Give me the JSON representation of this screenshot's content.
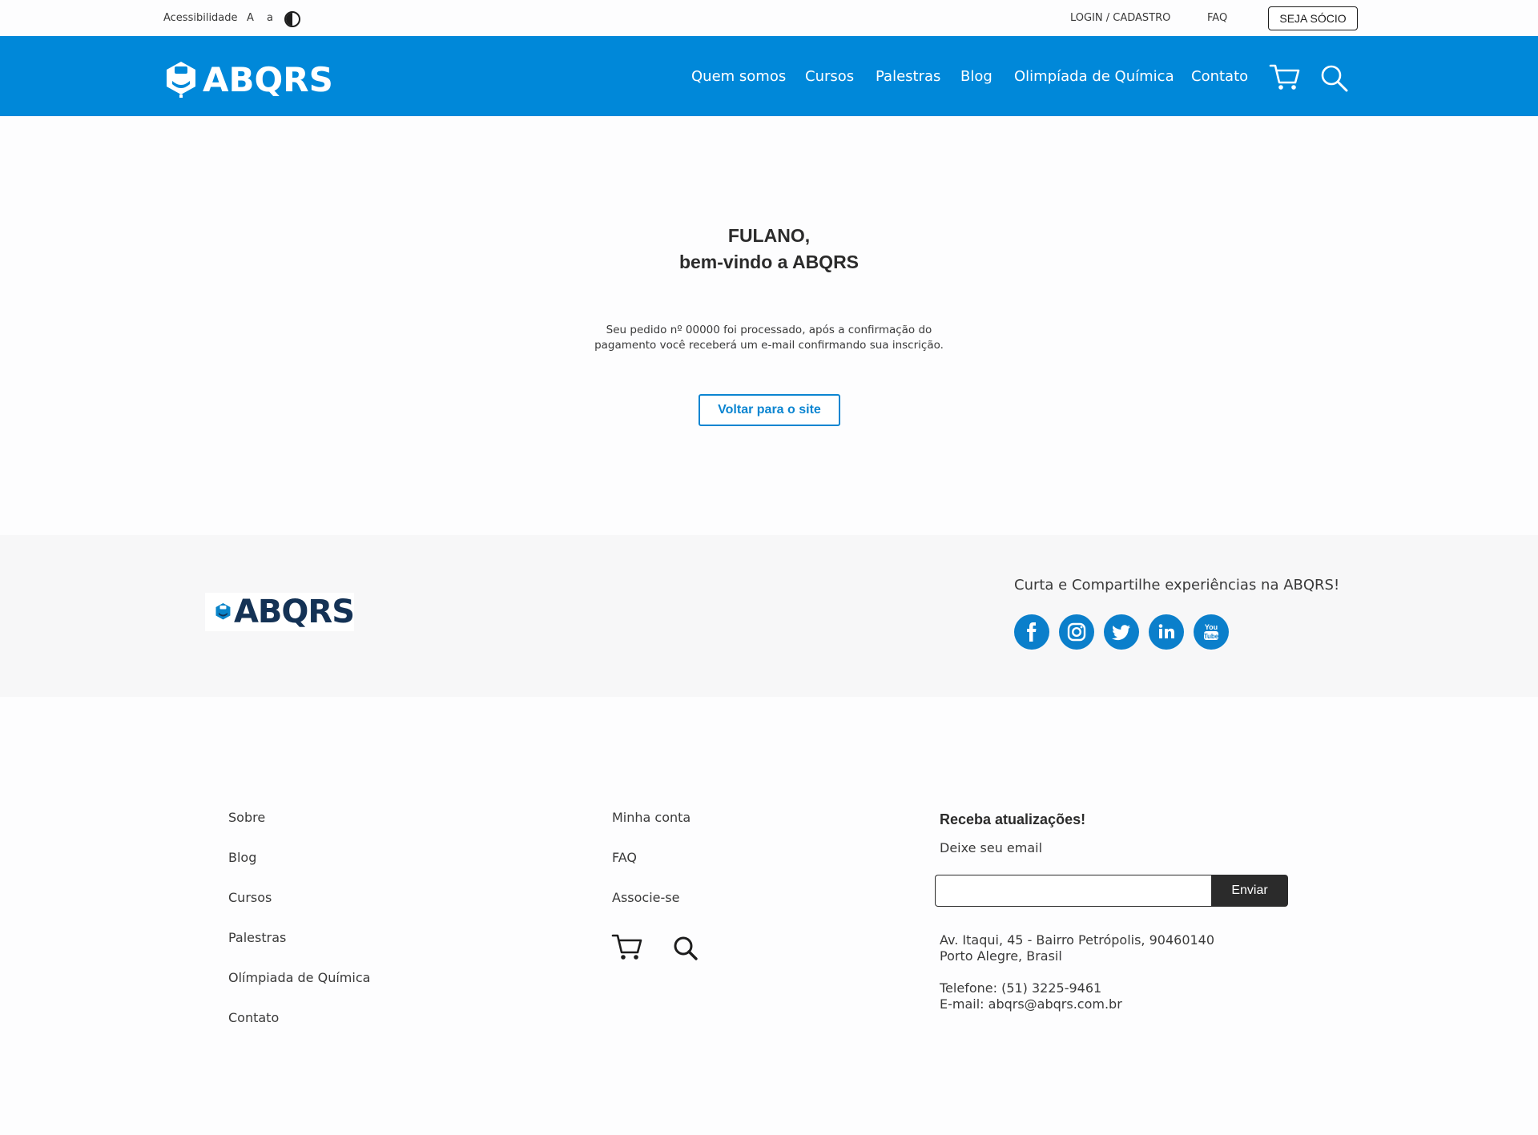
{
  "topbar": {
    "accessibility_label": "Acessibilidade",
    "font_increase": "A",
    "font_decrease": "a",
    "contrast_icon": "contrast-icon",
    "login_label": "LOGIN / CADASTRO",
    "faq_label": "FAQ",
    "socio_label": "SEJA SÓCIO"
  },
  "header": {
    "logo_text": "ABQRS",
    "nav": [
      "Quem somos",
      "Cursos",
      "Palestras",
      "Blog",
      "Olimpíada de Química",
      "Contato"
    ],
    "cart_icon": "cart-icon",
    "search_icon": "search-icon"
  },
  "main": {
    "greeting_line1": "FULANO,",
    "greeting_line2": "bem-vindo a ABQRS",
    "message_line1": "Seu pedido nº 00000 foi processado, após a confirmação do",
    "message_line2": "pagamento você receberá um e-mail confirmando sua inscrição.",
    "back_button": "Voltar para o site"
  },
  "social_band": {
    "logo_text": "ABQRS",
    "tagline": "Curta e Compartilhe experiências na ABQRS!",
    "networks": [
      "facebook-icon",
      "instagram-icon",
      "twitter-icon",
      "linkedin-icon",
      "youtube-icon"
    ]
  },
  "footer": {
    "col1": [
      "Sobre",
      "Blog",
      "Cursos",
      "Palestras",
      "Olímpiada de Química",
      "Contato"
    ],
    "col2": [
      "Minha conta",
      "FAQ",
      "Associe-se"
    ],
    "newsletter_title": "Receba atualizações!",
    "newsletter_sub": "Deixe seu email",
    "email_value": "",
    "send_button": "Enviar",
    "address_line1": "Av. Itaqui, 45 - Bairro Petrópolis, 90460140",
    "address_line2": "Porto Alegre, Brasil",
    "phone": "Telefone: (51) 3225-9461",
    "email": "E-mail: abqrs@abqrs.com.br"
  },
  "colors": {
    "brand_blue": "#0088d9",
    "logo_navy": "#143255",
    "dark_button": "#2b2b2b"
  }
}
